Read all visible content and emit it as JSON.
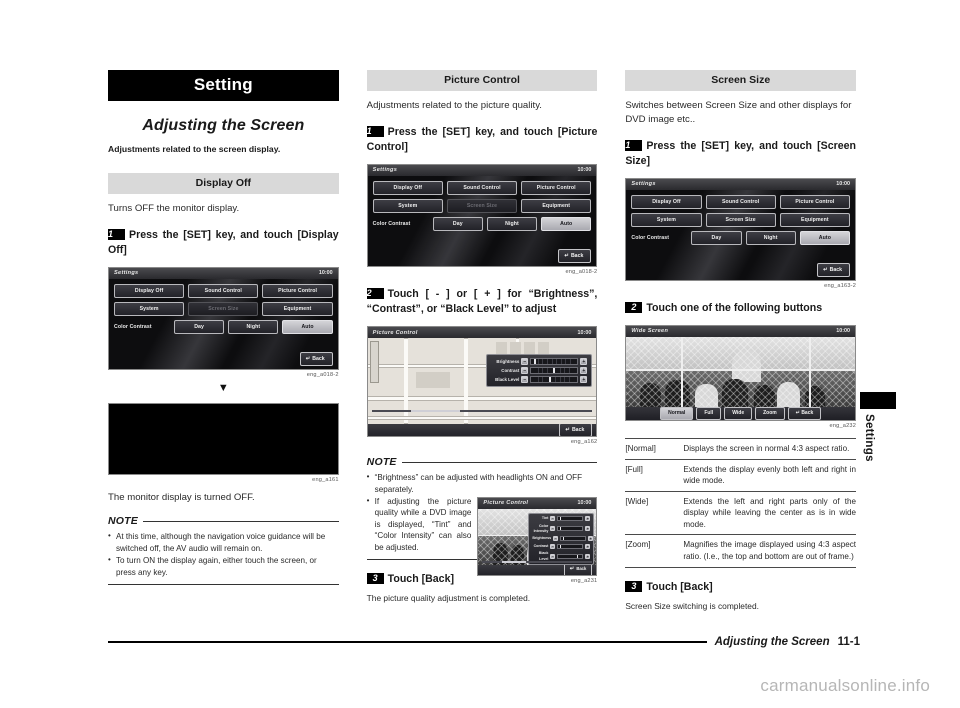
{
  "document": {
    "title_bar": "Setting",
    "section_title": "Adjusting the Screen",
    "section_lead": "Adjustments related to the screen display.",
    "footer_title": "Adjusting the Screen",
    "footer_page": "11-1",
    "side_tab_label": "Settings",
    "watermark": "carmanualsonline.info"
  },
  "columns": {
    "display_off": {
      "heading": "Display Off",
      "intro": "Turns OFF the monitor display.",
      "step1": {
        "num": "1",
        "text": "Press the [SET] key, and touch [Display Off]"
      },
      "figure1": {
        "caption": "eng_a018-2",
        "screen": {
          "title": "Settings",
          "clock": "10:00",
          "row1": [
            "Display Off",
            "Sound Control",
            "Picture Control"
          ],
          "row2": [
            "System",
            "Screen Size",
            "Equipment"
          ],
          "row2_disabled": "Screen Size",
          "contrast_label": "Color Contrast",
          "contrast_options": [
            "Day",
            "Night",
            "Auto"
          ],
          "contrast_selected": "Auto",
          "back_label": "Back"
        }
      },
      "arrow": "▼",
      "figure2": {
        "caption": "eng_a161"
      },
      "result": "The monitor display is turned OFF.",
      "note": {
        "label": "NOTE",
        "items": [
          "At this time, although the navigation voice guidance will be switched off, the AV audio will remain on.",
          "To turn ON the display again, either touch the screen, or press any key."
        ]
      }
    },
    "picture_control": {
      "heading": "Picture Control",
      "intro": "Adjustments related to the picture quality.",
      "step1": {
        "num": "1",
        "text": "Press the [SET] key, and touch [Picture Control]"
      },
      "figure1": {
        "caption": "eng_a018-2",
        "screen": {
          "title": "Settings",
          "clock": "10:00",
          "row1": [
            "Display Off",
            "Sound Control",
            "Picture Control"
          ],
          "row2": [
            "System",
            "Screen Size",
            "Equipment"
          ],
          "row2_disabled": "Screen Size",
          "contrast_label": "Color Contrast",
          "contrast_options": [
            "Day",
            "Night",
            "Auto"
          ],
          "contrast_selected": "Auto",
          "back_label": "Back"
        }
      },
      "step2": {
        "num": "2",
        "text": "Touch [ - ] or [ + ] for “Brightness”, “Contrast”, or “Black Level” to adjust"
      },
      "figure2": {
        "caption": "eng_a162",
        "screen": {
          "title": "Picture Control",
          "clock": "10:00",
          "minus": "−",
          "plus": "+",
          "back_label": "Back",
          "sliders": [
            {
              "name": "Brightness",
              "percent": 8
            },
            {
              "name": "Contrast",
              "percent": 50
            },
            {
              "name": "Black Level",
              "percent": 40
            }
          ]
        }
      },
      "note": {
        "label": "NOTE",
        "items": [
          "“Brightness” can be adjusted with headlights ON and OFF separately.",
          "If adjusting the picture quality while a DVD image is displayed, “Tint” and “Color Intensity” can also be adjusted."
        ],
        "inset_figure": {
          "caption": "eng_a231",
          "screen": {
            "title": "Picture Control",
            "clock": "10:00",
            "minus": "−",
            "plus": "+",
            "back_label": "Back",
            "sliders": [
              {
                "name": "Tint",
                "percent": 8
              },
              {
                "name": "Color Intensity",
                "percent": 8
              },
              {
                "name": "Brightness",
                "percent": 8
              },
              {
                "name": "Contrast",
                "percent": 8
              },
              {
                "name": "Black Level",
                "percent": 78
              }
            ]
          }
        }
      },
      "step3": {
        "num": "3",
        "text": "Touch [Back]"
      },
      "result": "The picture quality adjustment is completed."
    },
    "screen_size": {
      "heading": "Screen Size",
      "intro": "Switches between Screen Size and other displays for DVD image etc..",
      "step1": {
        "num": "1",
        "text": "Press the [SET] key, and touch [Screen Size]"
      },
      "figure1": {
        "caption": "eng_a163-2",
        "screen": {
          "title": "Settings",
          "clock": "10:00",
          "row1": [
            "Display Off",
            "Sound Control",
            "Picture Control"
          ],
          "row2": [
            "System",
            "Screen Size",
            "Equipment"
          ],
          "row2_disabled": "",
          "contrast_label": "Color Contrast",
          "contrast_options": [
            "Day",
            "Night",
            "Auto"
          ],
          "contrast_selected": "Auto",
          "back_label": "Back"
        }
      },
      "step2": {
        "num": "2",
        "text": "Touch one of the following buttons"
      },
      "figure2": {
        "caption": "eng_a232",
        "screen": {
          "title": "Wide Screen",
          "clock": "10:00",
          "buttons": [
            "Normal",
            "Full",
            "Wide",
            "Zoom"
          ],
          "selected": "Normal",
          "back_label": "Back"
        }
      },
      "table": {
        "rows": [
          {
            "key": "[Normal]",
            "value": "Displays the screen in normal 4:3 aspect ratio."
          },
          {
            "key": "[Full]",
            "value": "Extends the display evenly both left and right in wide mode."
          },
          {
            "key": "[Wide]",
            "value": "Extends the left and right parts only of the display while leaving the center as is in wide mode."
          },
          {
            "key": "[Zoom]",
            "value": "Magnifies the image displayed using 4:3 aspect ratio. (I.e., the top and bottom are out of frame.)"
          }
        ]
      },
      "step3": {
        "num": "3",
        "text": "Touch [Back]"
      },
      "result": "Screen Size switching is completed."
    }
  }
}
